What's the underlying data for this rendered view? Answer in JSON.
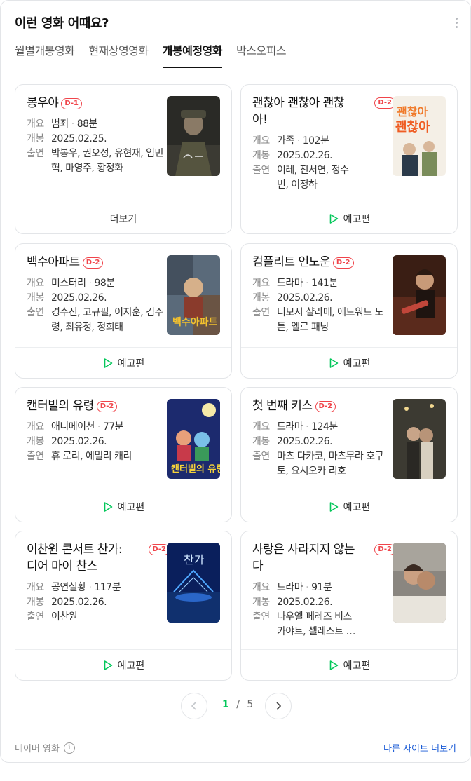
{
  "header": {
    "title": "이런 영화 어때요?",
    "more_icon": "more-vertical-icon"
  },
  "tabs": [
    {
      "label": "월별개봉영화",
      "active": false
    },
    {
      "label": "현재상영영화",
      "active": false
    },
    {
      "label": "개봉예정영화",
      "active": true
    },
    {
      "label": "박스오피스",
      "active": false
    }
  ],
  "labels": {
    "genre": "개요",
    "release": "개봉",
    "cast": "출연",
    "dot": "·"
  },
  "movies": [
    {
      "title": "봉우야",
      "badge": "D-1",
      "genre": "범죄",
      "runtime": "88분",
      "release": "2025.02.25.",
      "cast": "박봉우, 권오성, 유현재, 임민혁, 마영주, 황정화",
      "action": "더보기",
      "poster_bg": "#2a2a26",
      "poster_accent": "#6b6a55"
    },
    {
      "title": "괜찮아 괜찮아 괜찮아!",
      "badge": "D-2",
      "genre": "가족",
      "runtime": "102분",
      "release": "2025.02.26.",
      "cast": "이레, 진서연, 정수빈, 이정하",
      "action": "예고편",
      "poster_bg": "#f4efe6",
      "poster_accent": "#f07a2a"
    },
    {
      "title": "백수아파트",
      "badge": "D-2",
      "genre": "미스터리",
      "runtime": "98분",
      "release": "2025.02.26.",
      "cast": "경수진, 고규필, 이지훈, 김주령, 최유정, 정희태",
      "action": "예고편",
      "poster_bg": "#5a6a7a",
      "poster_accent": "#f2c12e"
    },
    {
      "title": "컴플리트 언노운",
      "badge": "D-2",
      "genre": "드라마",
      "runtime": "141분",
      "release": "2025.02.26.",
      "cast": "티모시 샬라메, 에드워드 노튼, 엘르 패닝",
      "action": "예고편",
      "poster_bg": "#3a1e14",
      "poster_accent": "#c0463a"
    },
    {
      "title": "캔터빌의 유령",
      "badge": "D-2",
      "genre": "애니메이션",
      "runtime": "77분",
      "release": "2025.02.26.",
      "cast": "휴 로리, 에밀리 캐리",
      "action": "예고편",
      "poster_bg": "#1c2a6e",
      "poster_accent": "#f5d23a"
    },
    {
      "title": "첫 번째 키스",
      "badge": "D-2",
      "genre": "드라마",
      "runtime": "124분",
      "release": "2025.02.26.",
      "cast": "마츠 다카코, 마츠무라 호쿠토, 요시오카 리호",
      "action": "예고편",
      "poster_bg": "#3c3a32",
      "poster_accent": "#c7b48a"
    },
    {
      "title": "이찬원 콘서트 찬가: 디어 마이 찬스",
      "badge": "D-2",
      "genre": "공연실황",
      "runtime": "117분",
      "release": "2025.02.26.",
      "cast": "이찬원",
      "action": "예고편",
      "poster_bg": "#0a1f5c",
      "poster_accent": "#4fa8ff"
    },
    {
      "title": "사랑은 사라지지 않는다",
      "badge": "D-2",
      "genre": "드라마",
      "runtime": "91분",
      "release": "2025.02.26.",
      "cast": "나우엘 페레즈 비스카야트, 셀레스트 브룬켈",
      "action": "예고편",
      "poster_bg": "#8a8680",
      "poster_accent": "#e8e4dc"
    }
  ],
  "pager": {
    "current": "1",
    "separator": "/",
    "total": "5"
  },
  "footer": {
    "source": "네이버 영화",
    "more_link": "다른 사이트 더보기"
  },
  "icons": {
    "play": "play-triangle-icon",
    "prev": "chevron-left-icon",
    "next": "chevron-right-icon",
    "info": "info-icon"
  },
  "colors": {
    "accent_green": "#03c75a",
    "badge_red": "#f0444a",
    "link_blue": "#1a5bd6"
  }
}
